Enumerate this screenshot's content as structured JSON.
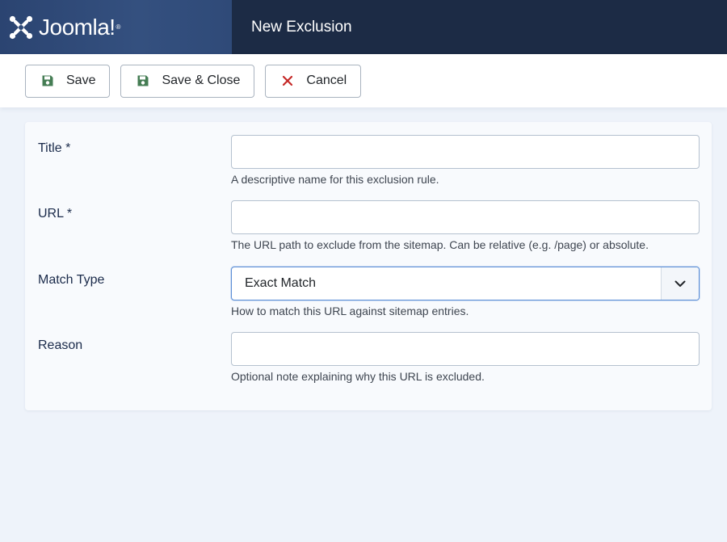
{
  "brand": {
    "name": "Joomla!",
    "mark_icon": "joomla-logo-icon"
  },
  "header": {
    "title": "New Exclusion"
  },
  "toolbar": {
    "save_label": "Save",
    "save_close_label": "Save & Close",
    "cancel_label": "Cancel",
    "save_icon": "floppy-disk-icon",
    "cancel_icon": "x-mark-icon"
  },
  "form": {
    "title": {
      "label": "Title *",
      "value": "",
      "hint": "A descriptive name for this exclusion rule."
    },
    "url": {
      "label": "URL *",
      "value": "",
      "hint": "The URL path to exclude from the sitemap. Can be relative (e.g. /page) or absolute."
    },
    "match_type": {
      "label": "Match Type",
      "selected": "Exact Match",
      "hint": "How to match this URL against sitemap entries."
    },
    "reason": {
      "label": "Reason",
      "value": "",
      "hint": "Optional note explaining why this URL is excluded."
    }
  },
  "colors": {
    "header_bg": "#1c2b45",
    "brand_bg": "#2f4a78",
    "save_icon": "#457d54",
    "cancel_icon": "#c52827",
    "focus_border": "#5b8ed6",
    "page_bg": "#eef3fa"
  }
}
